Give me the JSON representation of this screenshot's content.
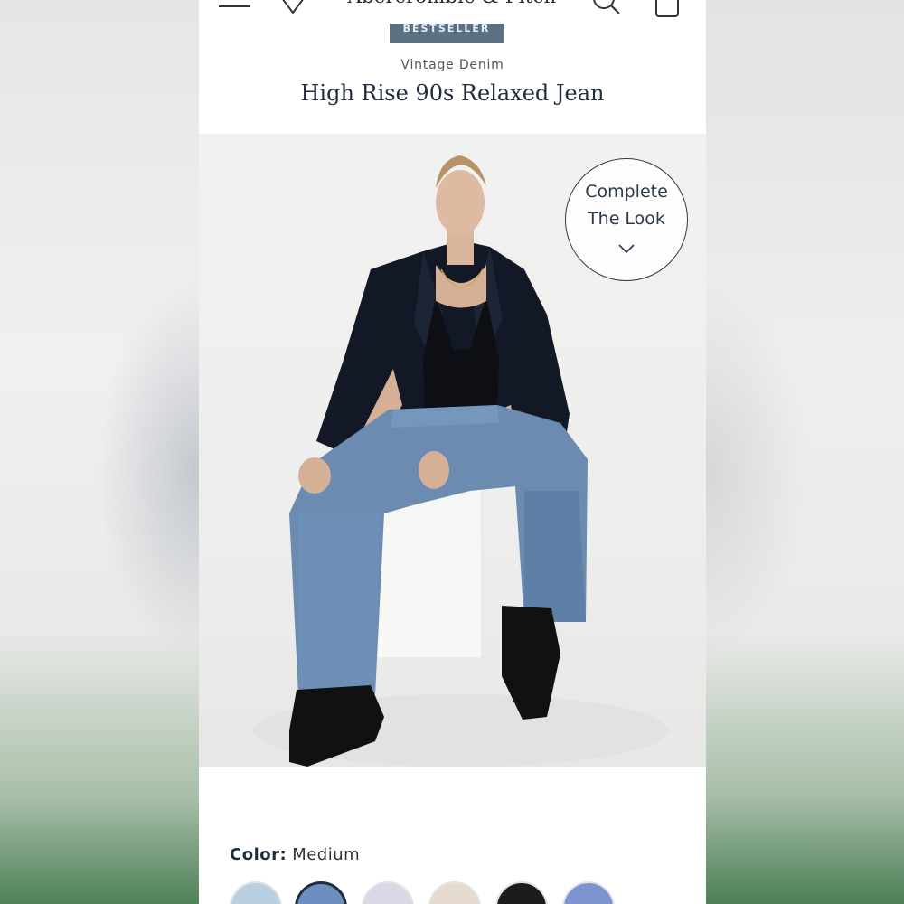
{
  "header": {
    "logo_text": "Abercrombie & Fitch",
    "badge_label": "BESTSELLER"
  },
  "product": {
    "collection": "Vintage Denim",
    "name": "High Rise 90s Relaxed Jean"
  },
  "complete_look": {
    "line1": "Complete",
    "line2": "The Look"
  },
  "color": {
    "label": "Color:",
    "selected": "Medium",
    "swatches": [
      {
        "name": "light-wash",
        "color": "#b9cfe2"
      },
      {
        "name": "medium",
        "color": "#6d8fc0",
        "selected": true
      },
      {
        "name": "lavender",
        "color": "#d9d8e6"
      },
      {
        "name": "beige",
        "color": "#e6dbcf"
      },
      {
        "name": "black",
        "color": "#1c1c1c"
      },
      {
        "name": "blue",
        "color": "#7d94d0"
      }
    ]
  },
  "icons": [
    "menu-icon",
    "heart-icon",
    "search-icon",
    "bag-icon",
    "chevron-down-icon"
  ],
  "colors": {
    "navy": "#1f2d3d",
    "badge": "#5b7083"
  }
}
